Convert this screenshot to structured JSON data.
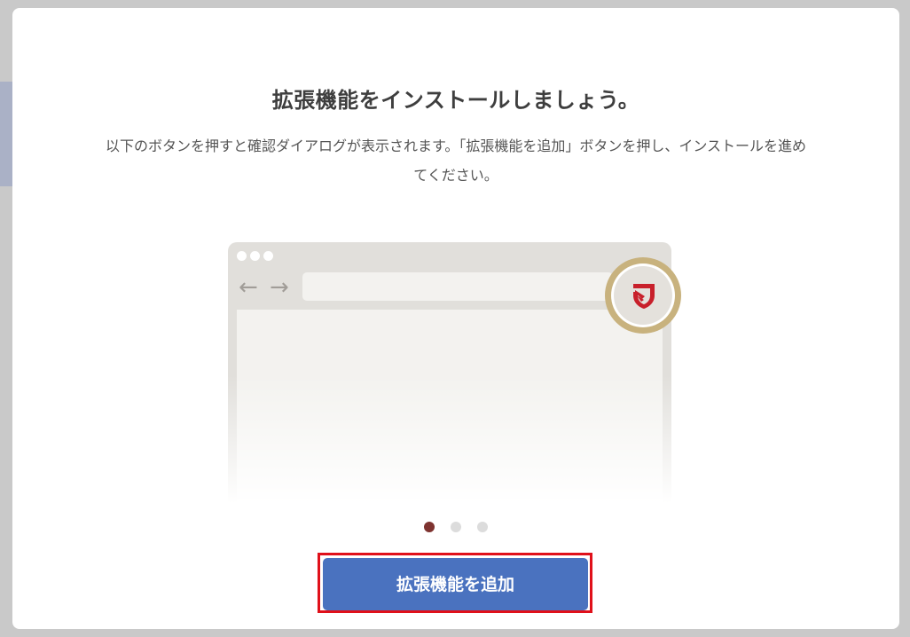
{
  "modal": {
    "title": "拡張機能をインストールしましょう。",
    "description": "以下のボタンを押すと確認ダイアログが表示されます。「拡張機能を追加」ボタンを押し、インストールを進めてください。"
  },
  "illustration": {
    "back_arrow": "←",
    "forward_arrow": "→",
    "extension_icon": "shield-logo-icon",
    "ring_color": "#c8b27e",
    "logo_color": "#c8202b"
  },
  "pagination": {
    "current": 1,
    "total": 3
  },
  "cta": {
    "label": "拡張機能を追加",
    "color": "#4a72bf",
    "highlight_color": "#e0101a"
  }
}
